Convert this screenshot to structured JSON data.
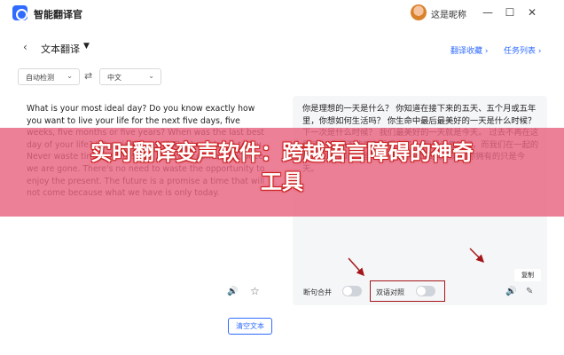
{
  "app": {
    "title": "智能翻译官"
  },
  "user": {
    "name": "这是昵称"
  },
  "window": {
    "minimize": "—",
    "maximize": "☐",
    "close": "✕"
  },
  "header": {
    "back": "‹",
    "mode": "文本翻译",
    "caret": "▼",
    "link_favorites": "翻译收藏 ›",
    "link_tasks": "任务列表 ›"
  },
  "languages": {
    "source": "自动检测",
    "target": "中文",
    "swap": "⇄"
  },
  "source_text": "What is your most ideal day? Do you know exactly how you want to live your life for the next five days, five weeks, five months or five years? When was the last best day of your life? When is the next? The best day is today. Never waste time. Life is short, We can't come back once we are gone. There's no need to waste the opportunity to enjoy the present. The future is a promise a time that will not come because what we have is only today.",
  "target_text": "你是理想的一天是什么？ 你知道在接下来的五天、五个月或五年里，你想如何生活吗？ 你生命中最后最美好的一天是什么时候？ 下一次是什么时候？ 我们最美好的一天就是今天。 过去不再在这里了。 我们不能再享受现在了。 我们浪费时间，而我们在一起的时光中最美好的是今天，我们永远没有明天，你拥有的只是今天。",
  "controls": {
    "sentence_merge": "断句合并",
    "bilingual": "双语对照",
    "copy": "复制",
    "clear": "清空文本"
  },
  "icons": {
    "speaker": "🔊",
    "star": "☆",
    "edit": "✎"
  },
  "banner": {
    "line1": "实时翻译变声软件：跨越语言障碍的神奇",
    "line2": "工具"
  }
}
